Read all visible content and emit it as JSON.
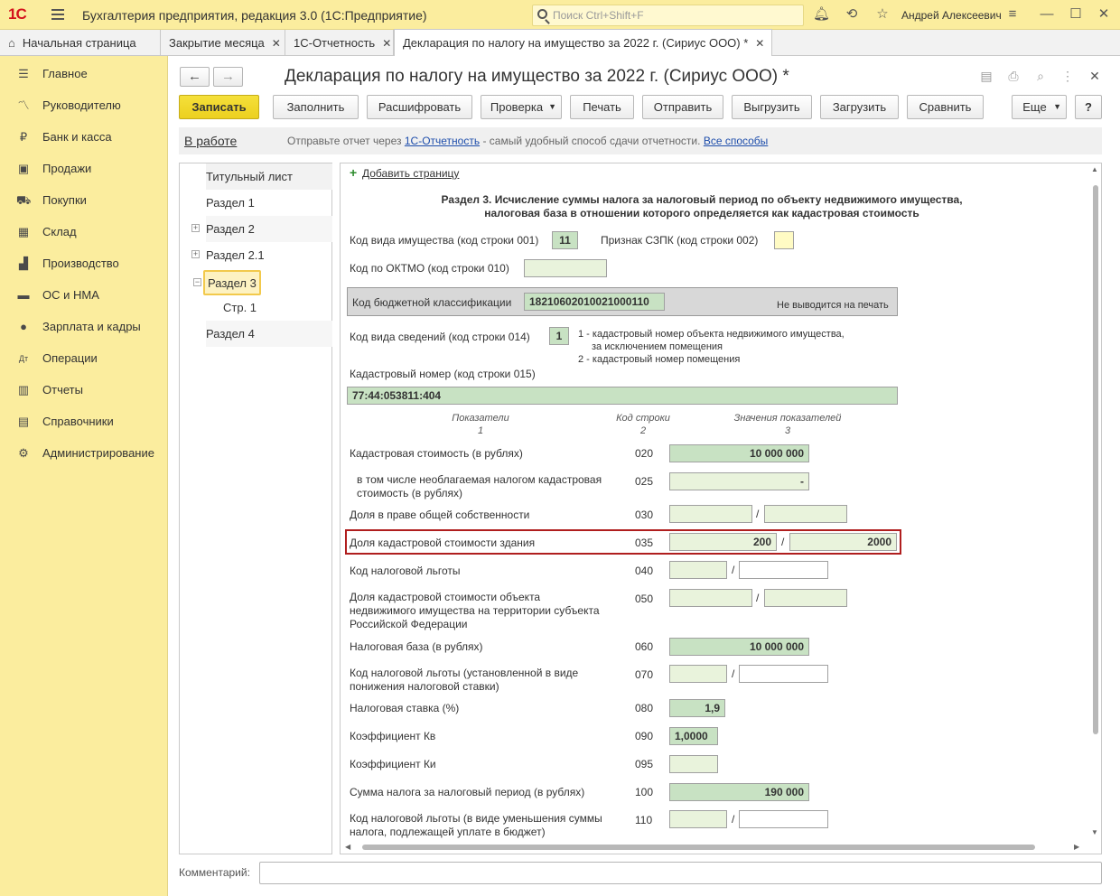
{
  "app": {
    "logo": "1С",
    "title": "Бухгалтерия предприятия, редакция 3.0  (1С:Предприятие)",
    "search_placeholder": "Поиск Ctrl+Shift+F",
    "user": "Андрей Алексеевич"
  },
  "tabs": [
    {
      "label": "Начальная страница"
    },
    {
      "label": "Закрытие месяца"
    },
    {
      "label": "1С-Отчетность"
    },
    {
      "label": "Декларация по налогу на имущество за 2022 г. (Сириус ООО) *"
    }
  ],
  "sidebar": [
    {
      "label": "Главное",
      "icon": "menu-icon"
    },
    {
      "label": "Руководителю",
      "icon": "chart-line-icon"
    },
    {
      "label": "Банк и касса",
      "icon": "coin-icon"
    },
    {
      "label": "Продажи",
      "icon": "bag-icon"
    },
    {
      "label": "Покупки",
      "icon": "cart-icon"
    },
    {
      "label": "Склад",
      "icon": "warehouse-icon"
    },
    {
      "label": "Производство",
      "icon": "factory-icon"
    },
    {
      "label": "ОС и НМА",
      "icon": "truck-icon"
    },
    {
      "label": "Зарплата и кадры",
      "icon": "people-icon"
    },
    {
      "label": "Операции",
      "icon": "dt-kt-icon"
    },
    {
      "label": "Отчеты",
      "icon": "bar-chart-icon"
    },
    {
      "label": "Справочники",
      "icon": "book-icon"
    },
    {
      "label": "Администрирование",
      "icon": "gear-icon"
    }
  ],
  "doc": {
    "title": "Декларация по налогу на имущество за 2022 г. (Сириус ООО) *",
    "buttons": {
      "save": "Записать",
      "fill": "Заполнить",
      "decode": "Расшифровать",
      "check": "Проверка",
      "print": "Печать",
      "send": "Отправить",
      "unload": "Выгрузить",
      "load": "Загрузить",
      "compare": "Сравнить",
      "more": "Еще",
      "help": "?"
    },
    "status": "В работе",
    "info_prefix": "Отправьте отчет через",
    "info_link": "1С-Отчетность",
    "info_middle": "- самый удобный способ сдачи отчетности.",
    "info_link2": "Все способы",
    "comment_label": "Комментарий:"
  },
  "tree": [
    {
      "label": "Титульный лист"
    },
    {
      "label": "Раздел 1"
    },
    {
      "label": "Раздел 2"
    },
    {
      "label": "Раздел 2.1"
    },
    {
      "label": "Раздел 3"
    },
    {
      "label": "Стр. 1"
    },
    {
      "label": "Раздел 4"
    }
  ],
  "form": {
    "add_page": "Добавить страницу",
    "section_title_1": "Раздел 3. Исчисление суммы налога за налоговый период по объекту недвижимого имущества,",
    "section_title_2": "налоговая база в отношении которого определяется как кадастровая стоимость",
    "l001": "Код вида имущества (код строки 001)",
    "v001": "11",
    "l002": "Признак СЗПК (код строки 002)",
    "l010": "Код по ОКТМО (код строки 010)",
    "kbk_label": "Код бюджетной классификации",
    "kbk_value": "18210602010021000110",
    "no_print": "Не выводится на печать",
    "l014": "Код вида сведений (код строки 014)",
    "v014": "1",
    "n014_1": "1 - кадастровый номер объекта недвижимого имущества,",
    "n014_2": "за исключением помещения",
    "n014_3": "2 - кадастровый номер помещения",
    "l015": "Кадастровый номер (код строки 015)",
    "v015": "77:44:053811:404",
    "h1": "Показатели",
    "h1n": "1",
    "h2": "Код строки",
    "h2n": "2",
    "h3": "Значения показателей",
    "h3n": "3",
    "rows": {
      "r020": {
        "label": "Кадастровая стоимость (в рублях)",
        "code": "020",
        "value": "10 000 000"
      },
      "r025": {
        "label1": "в том числе необлагаемая налогом кадастровая",
        "label2": "стоимость (в рублях)",
        "code": "025",
        "value": "-"
      },
      "r030": {
        "label": "Доля в праве общей собственности",
        "code": "030"
      },
      "r035": {
        "label": "Доля кадастровой стоимости здания",
        "code": "035",
        "v1": "200",
        "v2": "2000"
      },
      "r040": {
        "label": "Код налоговой льготы",
        "code": "040"
      },
      "r050": {
        "label1": "Доля кадастровой стоимости объекта",
        "label2": "недвижимого имущества на территории субъекта",
        "label3": "Российской Федерации",
        "code": "050"
      },
      "r060": {
        "label": "Налоговая база (в рублях)",
        "code": "060",
        "value": "10 000 000"
      },
      "r070": {
        "label1": "Код налоговой льготы (установленной в виде",
        "label2": "понижения налоговой ставки)",
        "code": "070"
      },
      "r080": {
        "label": "Налоговая ставка (%)",
        "code": "080",
        "value": "1,9"
      },
      "r090": {
        "label": "Коэффициент Кв",
        "code": "090",
        "value": "1,0000"
      },
      "r095": {
        "label": "Коэффициент Ки",
        "code": "095"
      },
      "r100": {
        "label": "Сумма налога за налоговый период (в рублях)",
        "code": "100",
        "value": "190 000"
      },
      "r110": {
        "label1": "Код налоговой льготы (в виде уменьшения суммы",
        "label2": "налога, подлежащей уплате в бюджет)",
        "code": "110"
      }
    }
  },
  "colors": {
    "sidebar_bg": "#fbed9e",
    "save_button": "#f5e03a",
    "field_green": "#e9f3dc",
    "field_dark_green": "#c8e2c3",
    "highlight_border": "#b01e1e",
    "link": "#1d4dab"
  }
}
